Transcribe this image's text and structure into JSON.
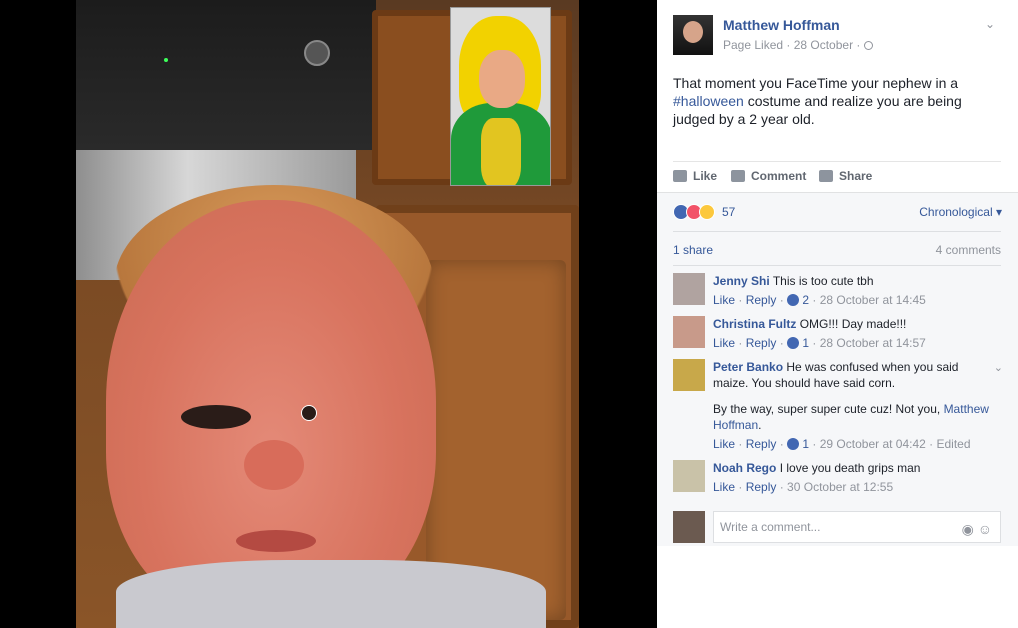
{
  "post": {
    "author": "Matthew Hoffman",
    "meta": "Page Liked · 28 October ·",
    "text_before": "That moment you FaceTime your nephew in a ",
    "hashtag": "#halloween",
    "text_after": " costume and realize you are being judged by a 2 year old."
  },
  "actions": {
    "like": "Like",
    "comment": "Comment",
    "share": "Share"
  },
  "stats": {
    "reaction_count": "57",
    "order": "Chronological",
    "shares": "1 share",
    "comments": "4 comments"
  },
  "comments": [
    {
      "name": "Jenny Shi",
      "text": "This is too cute tbh",
      "like": "Like",
      "reply": "Reply",
      "likes": "2",
      "time": "28 October at 14:45"
    },
    {
      "name": "Christina Fultz",
      "text": "OMG!!! Day made!!!",
      "like": "Like",
      "reply": "Reply",
      "likes": "1",
      "time": "28 October at 14:57"
    },
    {
      "name": "Peter Banko",
      "text": "He was confused when you said maize. You should have said corn.",
      "text2_before": "By the way, super super cute cuz! Not you, ",
      "text2_link": "Matthew Hoffman",
      "text2_after": ".",
      "like": "Like",
      "reply": "Reply",
      "likes": "1",
      "time": "29 October at 04:42",
      "edited": "Edited"
    },
    {
      "name": "Noah Rego",
      "text": "I love you death grips man",
      "like": "Like",
      "reply": "Reply",
      "time": "30 October at 12:55"
    }
  ],
  "composer": {
    "placeholder": "Write a comment..."
  },
  "icons": [
    "globe-icon",
    "chevron-down-icon",
    "thumbs-up-icon",
    "speech-bubble-icon",
    "share-arrow-icon",
    "camera-icon",
    "smiley-icon"
  ]
}
